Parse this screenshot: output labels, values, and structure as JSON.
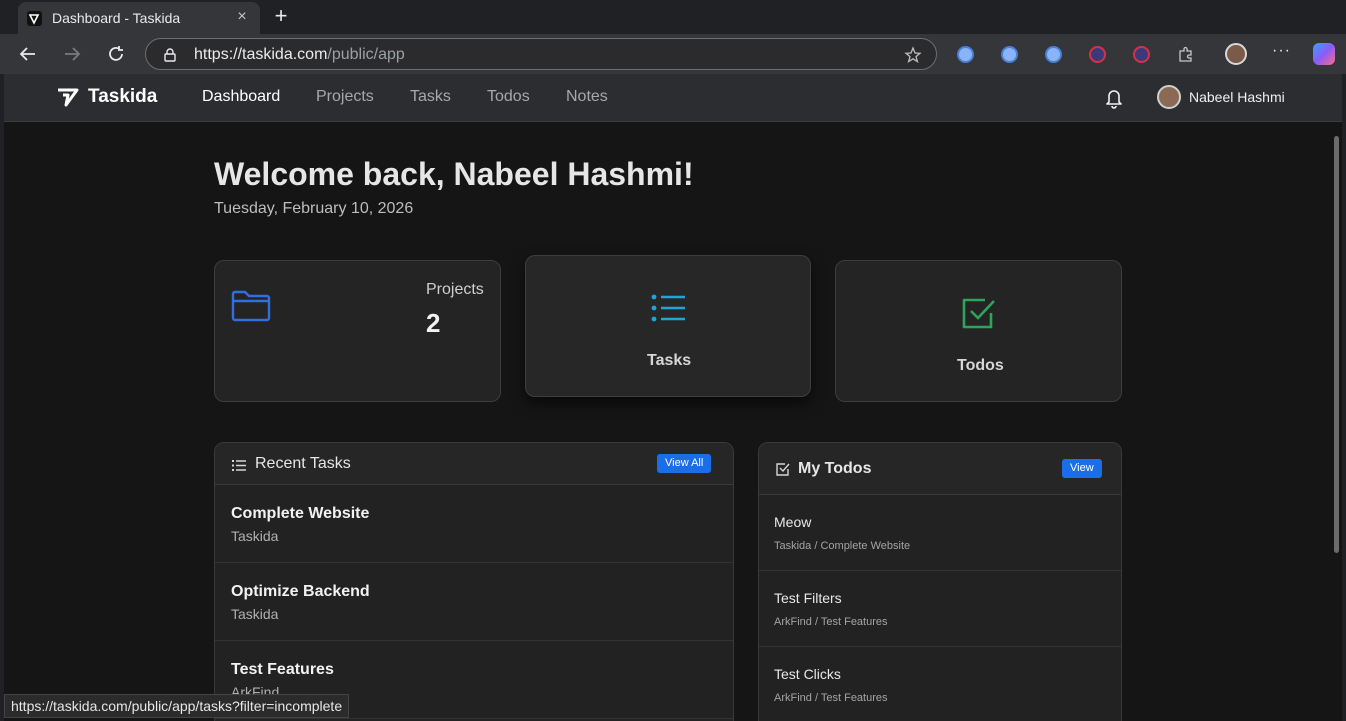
{
  "browser": {
    "tab_title": "Dashboard - Taskida",
    "tab_close": "×",
    "new_tab": "+",
    "url_host": "https://taskida.com",
    "url_path": "/public/app",
    "more": "···",
    "status_url": "https://taskida.com/public/app/tasks?filter=incomplete"
  },
  "app": {
    "brand": "Taskida",
    "nav": [
      "Dashboard",
      "Projects",
      "Tasks",
      "Todos",
      "Notes"
    ],
    "active_nav": "Dashboard",
    "user_name": "Nabeel Hashmi"
  },
  "header": {
    "welcome": "Welcome back, Nabeel Hashmi!",
    "date": "Tuesday, February 10, 2026"
  },
  "stats": {
    "projects_label": "Projects",
    "projects_value": "2",
    "tasks_label": "Tasks",
    "todos_label": "Todos"
  },
  "recent_tasks": {
    "title": "Recent Tasks",
    "button": "View All",
    "items": [
      {
        "title": "Complete Website",
        "project": "Taskida"
      },
      {
        "title": "Optimize Backend",
        "project": "Taskida"
      },
      {
        "title": "Test Features",
        "project": "ArkFind"
      }
    ]
  },
  "my_todos": {
    "title": "My Todos",
    "button": "View",
    "items": [
      {
        "title": "Meow",
        "path": "Taskida / Complete Website"
      },
      {
        "title": "Test Filters",
        "path": "ArkFind / Test Features"
      },
      {
        "title": "Test Clicks",
        "path": "ArkFind / Test Features"
      }
    ]
  },
  "colors": {
    "accent": "#1a6fe8",
    "projects_icon": "#2f6fe0",
    "tasks_icon": "#1ea7d6",
    "todos_icon": "#2ea35a"
  }
}
